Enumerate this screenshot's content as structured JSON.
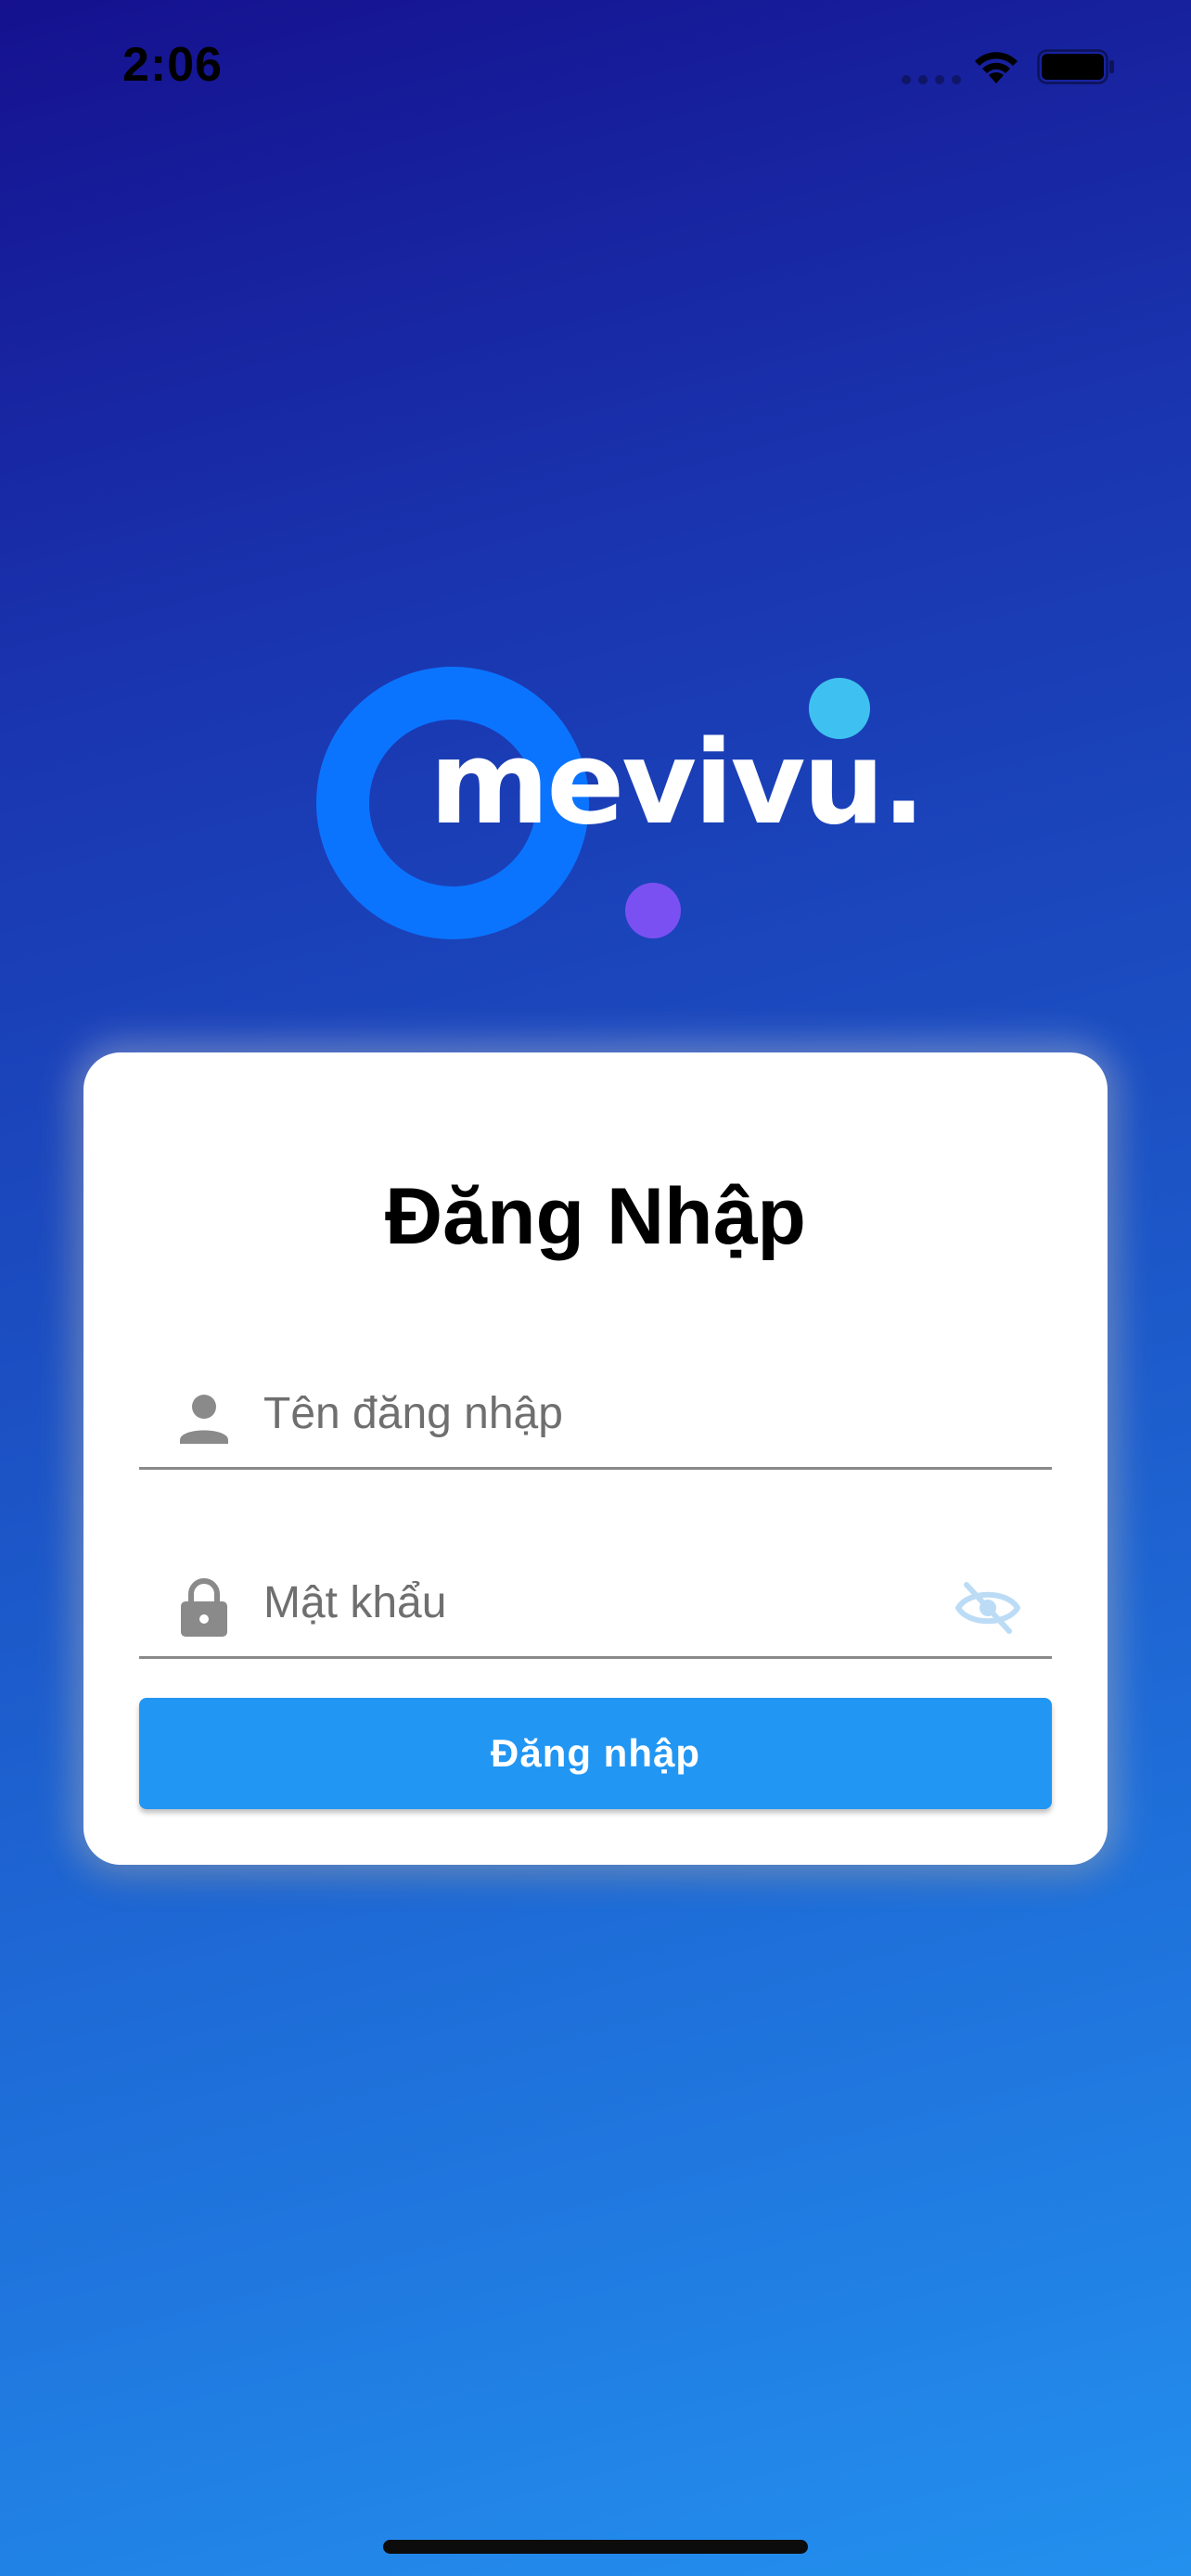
{
  "status_bar": {
    "time": "2:06",
    "icons": [
      "signal-dots-icon",
      "wifi-icon",
      "battery-icon"
    ]
  },
  "logo": {
    "text": "mevivu.",
    "colors": {
      "ring": "#0b74ff",
      "teal_dot": "#3ec1f0",
      "purple_dot": "#7b50f2"
    }
  },
  "login": {
    "title": "Đăng Nhập",
    "username": {
      "placeholder": "Tên đăng nhập",
      "value": "",
      "icon": "person-icon"
    },
    "password": {
      "placeholder": "Mật khẩu",
      "value": "",
      "icon": "lock-icon",
      "toggle_icon": "eye-off-icon"
    },
    "submit_label": "Đăng nhập"
  },
  "colors": {
    "accent": "#2196f3",
    "background_top": "#15118f",
    "background_bottom": "#2390ee"
  }
}
